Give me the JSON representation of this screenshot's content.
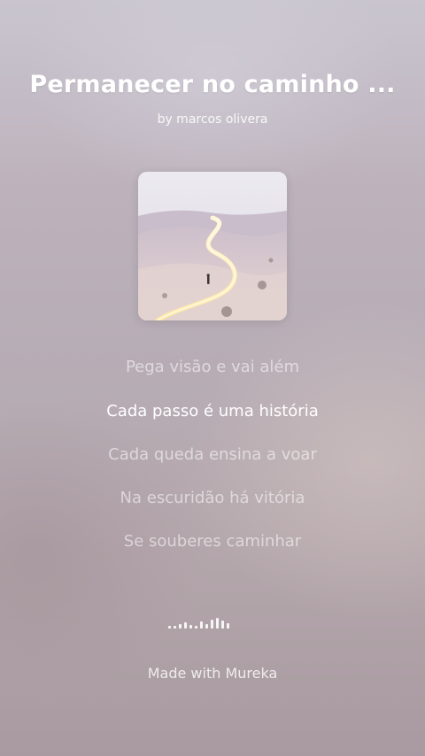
{
  "song": {
    "title": "Permanecer no caminho ...",
    "artist": "by marcos olivera"
  },
  "cover": {
    "icon": "album-cover-desert-path"
  },
  "lyrics": {
    "lines": [
      "Pega visão e vai além",
      "Cada passo é uma história",
      "Cada queda ensina a voar",
      "Na escuridão há vitória",
      "Se souberes caminhar"
    ],
    "active_index": 1
  },
  "player": {
    "waveform_icon": "audio-waveform-icon"
  },
  "footer": {
    "credit": "Made with Mureka"
  },
  "colors": {
    "text_primary": "#ffffff",
    "text_dim": "rgba(255,255,255,0.55)"
  }
}
